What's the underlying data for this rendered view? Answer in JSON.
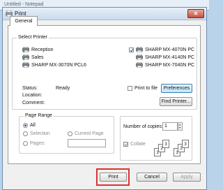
{
  "background_window": {
    "title": "Untitled - Notepad"
  },
  "dialog": {
    "title": "Print",
    "close_glyph": "✕"
  },
  "tabs": [
    {
      "label": "General"
    }
  ],
  "select_printer": {
    "label": "Select Printer",
    "printers": [
      {
        "name": "Reception"
      },
      {
        "name": "Sales"
      },
      {
        "name": "SHARP MX-3070N PCL6"
      },
      {
        "name": "SHARP MX-4070N PC",
        "selected": true
      },
      {
        "name": "SHARP MX-4140N PC"
      },
      {
        "name": "SHARP MX-7040N PC"
      }
    ],
    "status_label": "Status:",
    "status_value": "Ready",
    "location_label": "Location:",
    "comment_label": "Comment:",
    "print_to_file": "Print to file",
    "preferences_button": "Preferences",
    "find_printer_button": "Find Printer..."
  },
  "page_range": {
    "label": "Page Range",
    "all": "All",
    "selection": "Selection",
    "current_page": "Current Page",
    "pages": "Pages:"
  },
  "copies": {
    "number_label": "Number of copies:",
    "number_value": "1",
    "collate": "Collate"
  },
  "buttons": {
    "print": "Print",
    "cancel": "Cancel",
    "apply": "Apply"
  },
  "colors": {
    "highlight": "#e03030",
    "accent": "#2b5f9e"
  }
}
